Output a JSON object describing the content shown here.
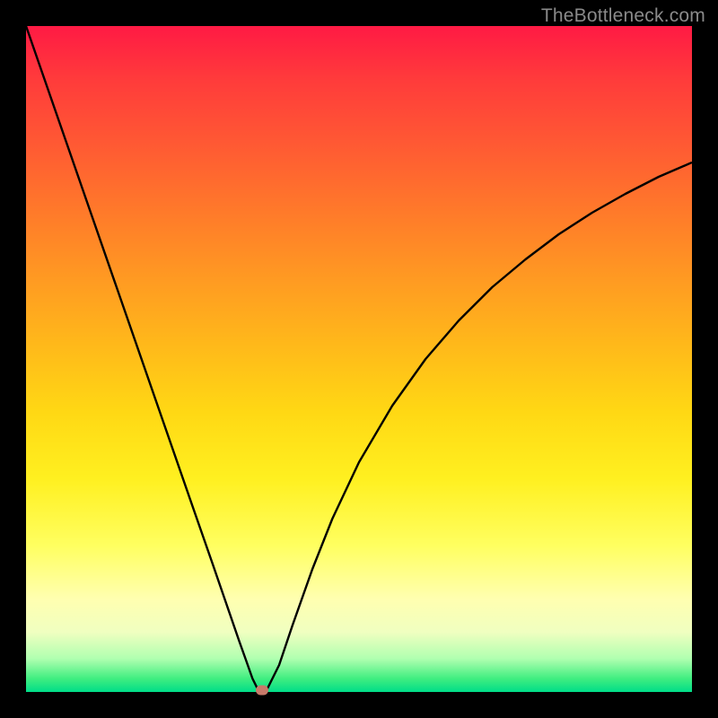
{
  "watermark": "TheBottleneck.com",
  "chart_data": {
    "type": "line",
    "title": "",
    "xlabel": "",
    "ylabel": "",
    "xlim": [
      0,
      100
    ],
    "ylim": [
      0,
      100
    ],
    "series": [
      {
        "name": "curve",
        "x": [
          0,
          5,
          10,
          15,
          20,
          25,
          28,
          30,
          32,
          33,
          34,
          35,
          36,
          38,
          40,
          43,
          46,
          50,
          55,
          60,
          65,
          70,
          75,
          80,
          85,
          90,
          95,
          100
        ],
        "values": [
          100,
          85.6,
          71.2,
          56.7,
          42.3,
          27.9,
          19.2,
          13.5,
          7.7,
          4.9,
          2.0,
          0.0,
          0.0,
          4.0,
          10.0,
          18.5,
          26.0,
          34.5,
          43.0,
          50.0,
          55.8,
          60.8,
          65.0,
          68.8,
          72.0,
          74.8,
          77.3,
          79.5
        ]
      }
    ],
    "marker": {
      "x": 35.5,
      "y": 0
    },
    "background": "rainbow-gradient-red-to-green"
  }
}
